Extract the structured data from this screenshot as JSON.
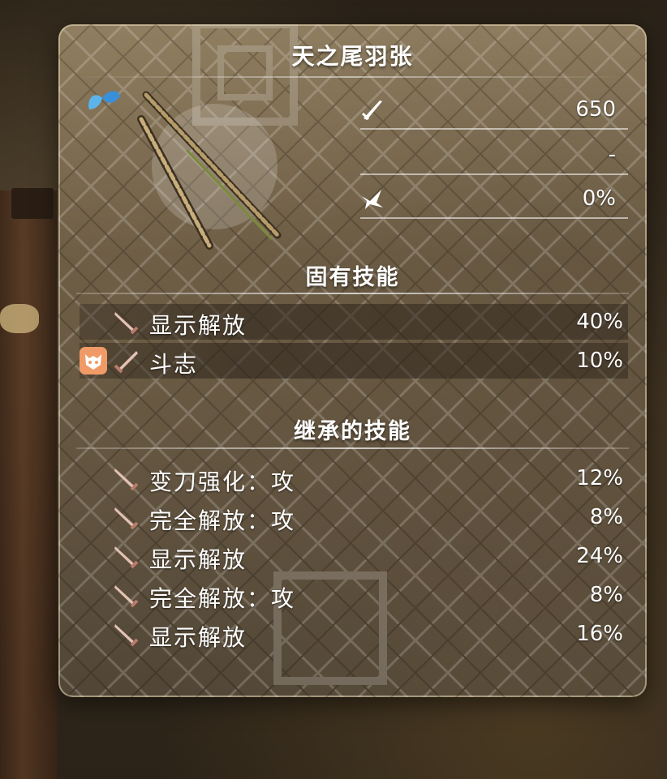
{
  "weapon": {
    "name": "天之尾羽张",
    "icons": {
      "weapon": "katana-icon",
      "crest": "clan-crest-icon",
      "rarity": "blue-butterfly-icon"
    }
  },
  "stats": [
    {
      "icon": "attack-sword-icon",
      "value": "650"
    },
    {
      "icon": "",
      "value": "-"
    },
    {
      "icon": "critical-claw-icon",
      "value": "0%"
    }
  ],
  "inherent": {
    "title": "固有技能",
    "skills": [
      {
        "name": "显示解放",
        "value": "40%",
        "badge": false
      },
      {
        "name": "斗志",
        "value": "10%",
        "badge": true,
        "badge_icon": "demon-mask-icon"
      }
    ]
  },
  "inherited": {
    "title": "继承的技能",
    "skills": [
      {
        "name": "变刀强化：攻",
        "value": "12%"
      },
      {
        "name": "完全解放：攻",
        "value": "8%"
      },
      {
        "name": "显示解放",
        "value": "24%"
      },
      {
        "name": "完全解放：攻",
        "value": "8%"
      },
      {
        "name": "显示解放",
        "value": "16%"
      }
    ]
  },
  "colors": {
    "accent": "#f09b67",
    "text": "#ffffff",
    "sword_icon": "#d9b3a3"
  }
}
